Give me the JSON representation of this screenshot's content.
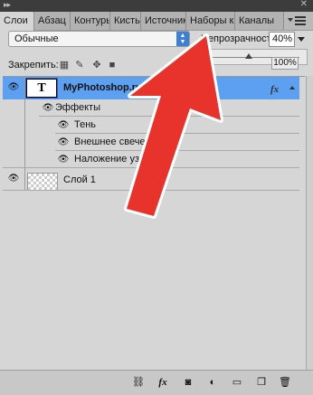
{
  "tabs": [
    {
      "label": "Слои",
      "active": true
    },
    {
      "label": "Абзац",
      "active": false
    },
    {
      "label": "Контуры",
      "active": false
    },
    {
      "label": "Кисть",
      "active": false
    },
    {
      "label": "Источник",
      "active": false
    },
    {
      "label": "Наборы к",
      "active": false
    },
    {
      "label": "Каналы",
      "active": false
    }
  ],
  "toolbar": {
    "blend_mode": "Обычные",
    "opacity_label": "Непрозрачность:",
    "opacity_value": "40%",
    "lock_label": "Закрепить:",
    "fill_partial": "100%"
  },
  "layers": [
    {
      "name": "MyPhotoshop.ru",
      "type": "text",
      "selected": true,
      "fx_icon": "fx"
    },
    {
      "name": "Эффекты",
      "type": "effects-group"
    },
    {
      "name": "Тень",
      "type": "effect"
    },
    {
      "name": "Внешнее свечение",
      "type": "effect"
    },
    {
      "name": "Наложение узора",
      "type": "effect"
    },
    {
      "name": "Слой 1",
      "type": "raster"
    }
  ],
  "text_thumb": "T",
  "fx_label": "fx",
  "colors": {
    "panel_bg": "#d6d6d6",
    "selected_row": "#5d9ff0",
    "annotation_arrow": "#e8332d"
  },
  "icons": [
    "link-layers-icon",
    "fx-icon",
    "mask-icon",
    "adjustment-layer-icon",
    "group-folder-icon",
    "new-layer-icon",
    "trash-icon"
  ]
}
